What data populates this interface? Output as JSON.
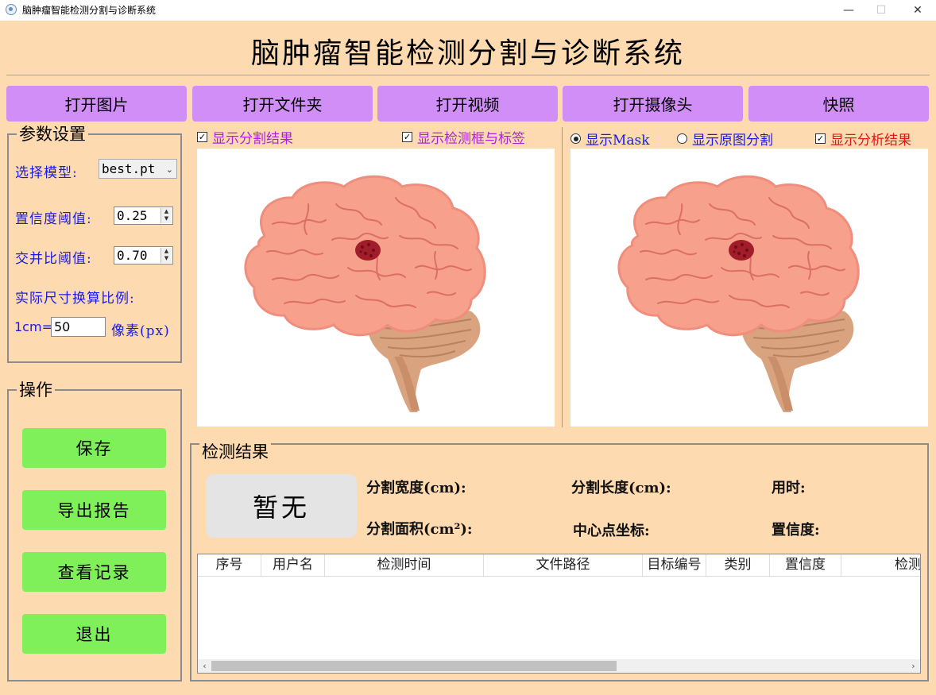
{
  "window": {
    "title": "脑肿瘤智能检测分割与诊断系统",
    "minimize": "—",
    "maximize": "☐",
    "close": "✕"
  },
  "header": {
    "title": "脑肿瘤智能检测分割与诊断系统"
  },
  "toolbar": {
    "open_image": "打开图片",
    "open_folder": "打开文件夹",
    "open_video": "打开视频",
    "open_camera": "打开摄像头",
    "snapshot": "快照"
  },
  "params": {
    "title": "参数设置",
    "model_label": "选择模型:",
    "model_value": "best.pt",
    "conf_label": "置信度阈值:",
    "conf_value": "0.25",
    "iou_label": "交并比阈值:",
    "iou_value": "0.70",
    "scale_label": "实际尺寸换算比例:",
    "scale_prefix": "1cm=",
    "scale_value": "50",
    "scale_unit": "像素(px)"
  },
  "operations": {
    "title": "操作",
    "save": "保存",
    "export": "导出报告",
    "history": "查看记录",
    "exit": "退出"
  },
  "left_view": {
    "show_seg": {
      "label": "显示分割结果",
      "checked": true
    },
    "show_box": {
      "label": "显示检测框与标签",
      "checked": true
    }
  },
  "right_view": {
    "show_mask": {
      "label": "显示Mask",
      "selected": true
    },
    "show_orig": {
      "label": "显示原图分割",
      "selected": false
    },
    "show_analysis": {
      "label": "显示分析结果",
      "checked": true
    }
  },
  "results": {
    "title": "检测结果",
    "status": "暂无",
    "seg_width": "分割宽度(cm):",
    "seg_length": "分割长度(cm):",
    "time": "用时:",
    "seg_area": "分割面积(cm²):",
    "center": "中心点坐标:",
    "confidence": "置信度:"
  },
  "table": {
    "columns": [
      "序号",
      "用户名",
      "检测时间",
      "文件路径",
      "目标编号",
      "类别",
      "置信度",
      "检测"
    ],
    "rows": []
  },
  "colors": {
    "background": "#fddab0",
    "top_button": "#d18ef7",
    "op_button": "#7ff05a",
    "label_blue": "#1a1ae6",
    "label_purple": "#b020e0",
    "label_red": "#e01818"
  },
  "icons": {
    "app": "app-logo-icon",
    "brain": "brain-illustration",
    "tumor": "tumor-marker"
  }
}
